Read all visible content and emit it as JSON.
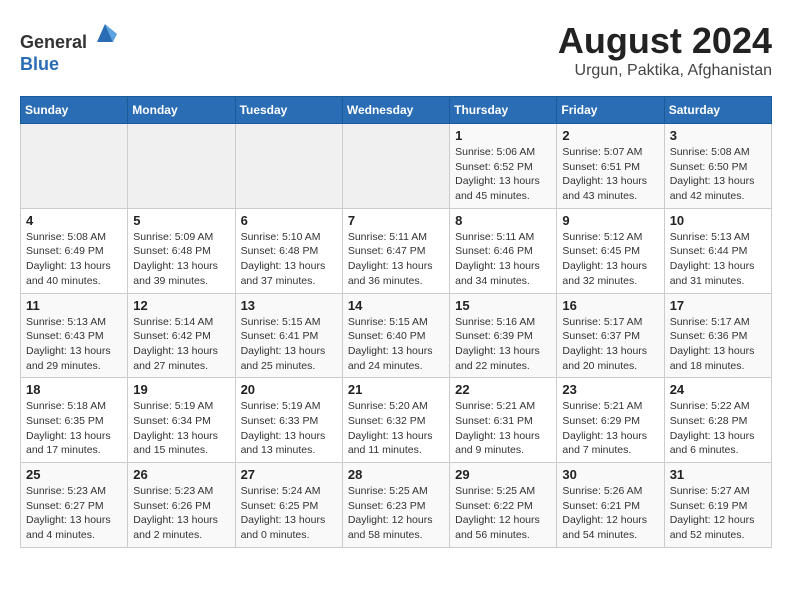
{
  "header": {
    "logo_line1": "General",
    "logo_line2": "Blue",
    "title": "August 2024",
    "subtitle": "Urgun, Paktika, Afghanistan"
  },
  "days_of_week": [
    "Sunday",
    "Monday",
    "Tuesday",
    "Wednesday",
    "Thursday",
    "Friday",
    "Saturday"
  ],
  "weeks": [
    [
      {
        "day": "",
        "info": ""
      },
      {
        "day": "",
        "info": ""
      },
      {
        "day": "",
        "info": ""
      },
      {
        "day": "",
        "info": ""
      },
      {
        "day": "1",
        "info": "Sunrise: 5:06 AM\nSunset: 6:52 PM\nDaylight: 13 hours\nand 45 minutes."
      },
      {
        "day": "2",
        "info": "Sunrise: 5:07 AM\nSunset: 6:51 PM\nDaylight: 13 hours\nand 43 minutes."
      },
      {
        "day": "3",
        "info": "Sunrise: 5:08 AM\nSunset: 6:50 PM\nDaylight: 13 hours\nand 42 minutes."
      }
    ],
    [
      {
        "day": "4",
        "info": "Sunrise: 5:08 AM\nSunset: 6:49 PM\nDaylight: 13 hours\nand 40 minutes."
      },
      {
        "day": "5",
        "info": "Sunrise: 5:09 AM\nSunset: 6:48 PM\nDaylight: 13 hours\nand 39 minutes."
      },
      {
        "day": "6",
        "info": "Sunrise: 5:10 AM\nSunset: 6:48 PM\nDaylight: 13 hours\nand 37 minutes."
      },
      {
        "day": "7",
        "info": "Sunrise: 5:11 AM\nSunset: 6:47 PM\nDaylight: 13 hours\nand 36 minutes."
      },
      {
        "day": "8",
        "info": "Sunrise: 5:11 AM\nSunset: 6:46 PM\nDaylight: 13 hours\nand 34 minutes."
      },
      {
        "day": "9",
        "info": "Sunrise: 5:12 AM\nSunset: 6:45 PM\nDaylight: 13 hours\nand 32 minutes."
      },
      {
        "day": "10",
        "info": "Sunrise: 5:13 AM\nSunset: 6:44 PM\nDaylight: 13 hours\nand 31 minutes."
      }
    ],
    [
      {
        "day": "11",
        "info": "Sunrise: 5:13 AM\nSunset: 6:43 PM\nDaylight: 13 hours\nand 29 minutes."
      },
      {
        "day": "12",
        "info": "Sunrise: 5:14 AM\nSunset: 6:42 PM\nDaylight: 13 hours\nand 27 minutes."
      },
      {
        "day": "13",
        "info": "Sunrise: 5:15 AM\nSunset: 6:41 PM\nDaylight: 13 hours\nand 25 minutes."
      },
      {
        "day": "14",
        "info": "Sunrise: 5:15 AM\nSunset: 6:40 PM\nDaylight: 13 hours\nand 24 minutes."
      },
      {
        "day": "15",
        "info": "Sunrise: 5:16 AM\nSunset: 6:39 PM\nDaylight: 13 hours\nand 22 minutes."
      },
      {
        "day": "16",
        "info": "Sunrise: 5:17 AM\nSunset: 6:37 PM\nDaylight: 13 hours\nand 20 minutes."
      },
      {
        "day": "17",
        "info": "Sunrise: 5:17 AM\nSunset: 6:36 PM\nDaylight: 13 hours\nand 18 minutes."
      }
    ],
    [
      {
        "day": "18",
        "info": "Sunrise: 5:18 AM\nSunset: 6:35 PM\nDaylight: 13 hours\nand 17 minutes."
      },
      {
        "day": "19",
        "info": "Sunrise: 5:19 AM\nSunset: 6:34 PM\nDaylight: 13 hours\nand 15 minutes."
      },
      {
        "day": "20",
        "info": "Sunrise: 5:19 AM\nSunset: 6:33 PM\nDaylight: 13 hours\nand 13 minutes."
      },
      {
        "day": "21",
        "info": "Sunrise: 5:20 AM\nSunset: 6:32 PM\nDaylight: 13 hours\nand 11 minutes."
      },
      {
        "day": "22",
        "info": "Sunrise: 5:21 AM\nSunset: 6:31 PM\nDaylight: 13 hours\nand 9 minutes."
      },
      {
        "day": "23",
        "info": "Sunrise: 5:21 AM\nSunset: 6:29 PM\nDaylight: 13 hours\nand 7 minutes."
      },
      {
        "day": "24",
        "info": "Sunrise: 5:22 AM\nSunset: 6:28 PM\nDaylight: 13 hours\nand 6 minutes."
      }
    ],
    [
      {
        "day": "25",
        "info": "Sunrise: 5:23 AM\nSunset: 6:27 PM\nDaylight: 13 hours\nand 4 minutes."
      },
      {
        "day": "26",
        "info": "Sunrise: 5:23 AM\nSunset: 6:26 PM\nDaylight: 13 hours\nand 2 minutes."
      },
      {
        "day": "27",
        "info": "Sunrise: 5:24 AM\nSunset: 6:25 PM\nDaylight: 13 hours\nand 0 minutes."
      },
      {
        "day": "28",
        "info": "Sunrise: 5:25 AM\nSunset: 6:23 PM\nDaylight: 12 hours\nand 58 minutes."
      },
      {
        "day": "29",
        "info": "Sunrise: 5:25 AM\nSunset: 6:22 PM\nDaylight: 12 hours\nand 56 minutes."
      },
      {
        "day": "30",
        "info": "Sunrise: 5:26 AM\nSunset: 6:21 PM\nDaylight: 12 hours\nand 54 minutes."
      },
      {
        "day": "31",
        "info": "Sunrise: 5:27 AM\nSunset: 6:19 PM\nDaylight: 12 hours\nand 52 minutes."
      }
    ]
  ]
}
